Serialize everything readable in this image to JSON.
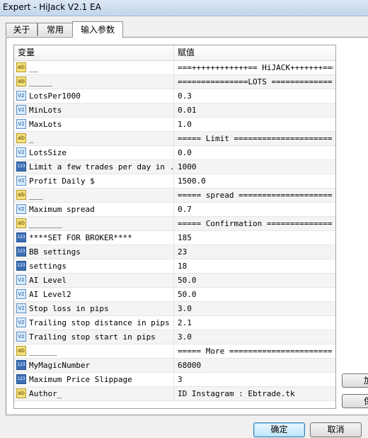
{
  "window": {
    "title": "Expert - HiJack V2.1 EA"
  },
  "tabs": [
    {
      "label": "关于"
    },
    {
      "label": "常用"
    },
    {
      "label": "输入参数"
    }
  ],
  "grid": {
    "header": {
      "variable": "变量",
      "value": "赋值"
    },
    "rows": [
      {
        "type": "ab",
        "name": "__",
        "value": "===++++++++++++== HiJACK+++++++===..."
      },
      {
        "type": "ab",
        "name": "_____",
        "value": "===============LOTS =============..."
      },
      {
        "type": "v2",
        "name": "LotsPer1000",
        "value": "0.3"
      },
      {
        "type": "v2",
        "name": "MinLots",
        "value": "0.01"
      },
      {
        "type": "v2",
        "name": "MaxLots",
        "value": "1.0"
      },
      {
        "type": "ab",
        "name": "_",
        "value": "===== Limit =====================..."
      },
      {
        "type": "v2",
        "name": "LotsSize",
        "value": "0.0"
      },
      {
        "type": "123",
        "name": "Limit a few trades per day in ...",
        "value": "1000"
      },
      {
        "type": "v2",
        "name": "Profit Daily $",
        "value": "1500.0"
      },
      {
        "type": "ab",
        "name": "___",
        "value": "===== spread ====================..."
      },
      {
        "type": "v2",
        "name": "Maximum spread",
        "value": "0.7"
      },
      {
        "type": "ab",
        "name": "_______",
        "value": "===== Confirmation ==============..."
      },
      {
        "type": "123",
        "name": "****SET FOR BROKER****",
        "value": "185"
      },
      {
        "type": "123",
        "name": "BB settings",
        "value": "23"
      },
      {
        "type": "123",
        "name": "settings",
        "value": "18"
      },
      {
        "type": "v2",
        "name": "AI Level",
        "value": "50.0"
      },
      {
        "type": "v2",
        "name": "AI Level2",
        "value": "50.0"
      },
      {
        "type": "v2",
        "name": "Stop loss in pips",
        "value": "3.0"
      },
      {
        "type": "v2",
        "name": "Trailing stop distance in pips",
        "value": "2.1"
      },
      {
        "type": "v2",
        "name": "Trailing stop start in pips",
        "value": "3.0"
      },
      {
        "type": "ab",
        "name": "______",
        "value": "===== More ======================..."
      },
      {
        "type": "123",
        "name": "MyMagicNumber",
        "value": "68000"
      },
      {
        "type": "123",
        "name": "Maximum Price Slippage",
        "value": "3"
      },
      {
        "type": "ab",
        "name": "Author_",
        "value": "ID Instagram : Ebtrade.tk"
      }
    ]
  },
  "icons": {
    "ab": "ab",
    "v2": "V2",
    "123": "123"
  },
  "side_buttons": [
    {
      "label": "加"
    },
    {
      "label": "保"
    }
  ],
  "footer": {
    "ok": "确定",
    "cancel": "取消"
  }
}
